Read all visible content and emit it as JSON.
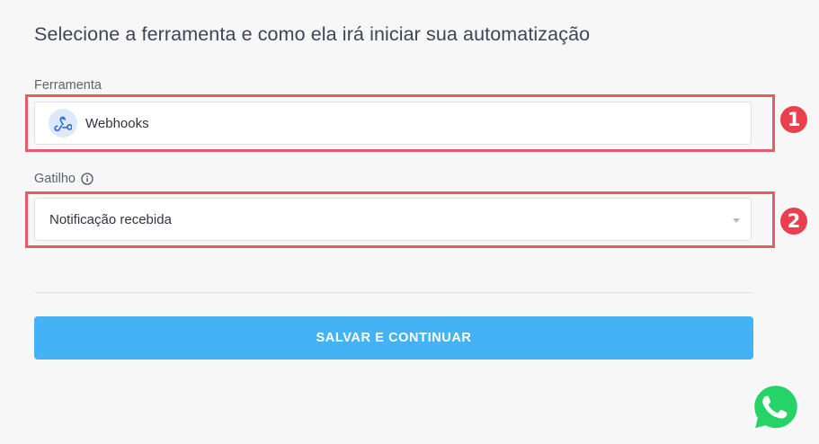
{
  "form": {
    "title": "Selecione a ferramenta e como ela irá iniciar sua automatização",
    "tool": {
      "label": "Ferramenta",
      "value": "Webhooks",
      "icon": "webhooks-icon",
      "badge_number": "1"
    },
    "trigger": {
      "label": "Gatilho",
      "value": "Notificação recebida",
      "info_icon": "info-icon",
      "badge_number": "2"
    },
    "submit_label": "SALVAR E CONTINUAR"
  },
  "floating": {
    "whatsapp_icon": "whatsapp-icon"
  },
  "colors": {
    "primary_button": "#43b3f5",
    "highlight": "#e85a64",
    "whatsapp": "#25d366"
  }
}
